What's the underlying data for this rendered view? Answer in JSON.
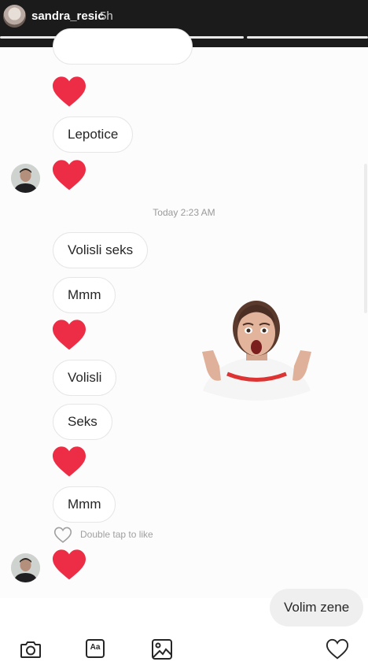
{
  "story": {
    "username": "sandra_resic",
    "time_ago": "5h"
  },
  "messages": [
    {
      "type": "heart"
    },
    {
      "type": "text",
      "text": "Lepotice"
    },
    {
      "type": "heart",
      "with_avatar": true
    },
    {
      "type": "timestamp",
      "text": "Today 2:23 AM"
    },
    {
      "type": "text",
      "text": "Volisli seks"
    },
    {
      "type": "text",
      "text": "Mmm"
    },
    {
      "type": "heart"
    },
    {
      "type": "text",
      "text": "Volisli"
    },
    {
      "type": "text",
      "text": "Seks"
    },
    {
      "type": "heart"
    },
    {
      "type": "text",
      "text": "Mmm"
    },
    {
      "type": "heart",
      "with_avatar": true
    }
  ],
  "labels": {
    "m_lepotice": "Lepotice",
    "timestamp": "Today 2:23 AM",
    "m_volisli_seks": "Volisli seks",
    "m_mmm_1": "Mmm",
    "m_volisli": "Volisli",
    "m_seks": "Seks",
    "m_mmm_2": "Mmm",
    "like_hint": "Double tap to like",
    "own_message": "Volim zene"
  },
  "toolbar": {
    "icons": [
      "camera-icon",
      "text-format-icon",
      "gallery-icon",
      "heart-outline-icon"
    ],
    "text_format_label": "Aa"
  },
  "colors": {
    "heart": "#ed2d45",
    "story_bar": "#1b1b1b"
  }
}
